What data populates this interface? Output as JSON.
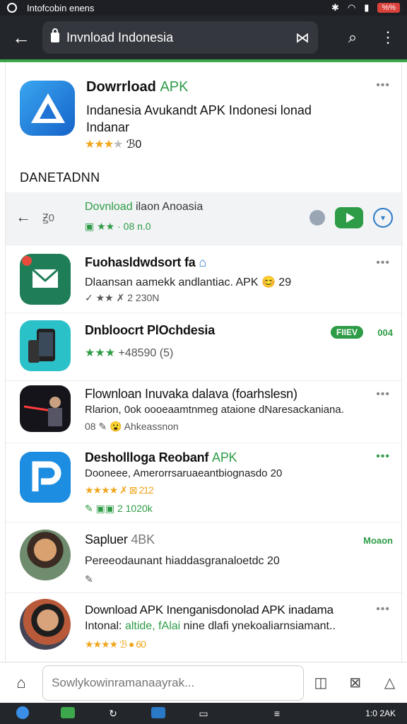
{
  "status_bar": {
    "title": "Intofcobin enens",
    "battery": "%%"
  },
  "toolbar": {
    "back_glyph": "←",
    "url": "Invnload Indonesia",
    "tabs_glyph": "⋈",
    "search_glyph": "⌕",
    "menu_glyph": "⋮"
  },
  "top_card": {
    "title": "Dowrrload",
    "title_accent": "APK",
    "description": "Indanesia Avukandt APK Indonesi lonad Indanar",
    "stars": "★★★",
    "rating_value": "ℬ0",
    "more": "•••"
  },
  "section_label": "DANETADNN",
  "download_bar": {
    "back_glyph": "←",
    "small": "Ꙃ0",
    "title_green": "Dovnload",
    "title_dark": "ilaon Anoasia",
    "meta": "▣ ★★ · 08 n.0"
  },
  "items": [
    {
      "name": "Fuohasldwdsort fa",
      "line": "Dlaansan aamekk andlantiac. APK",
      "line_accent": "😊 29",
      "meta": "✓ ★★ ✗ 2 230N",
      "more": "•••"
    },
    {
      "name": "Dnbloocrt PlOchdesia",
      "badge": "FIIEV",
      "side": "004",
      "meta_green": "★★★",
      "meta": "+48590  (5)"
    },
    {
      "name": "Flownloan Inuvaka dalava (foarhslesn)",
      "line": "Rlarion, 0ok oooeaamtnmeg ataione dNaresackaniana.",
      "meta": "08 ✎ 😮 Ahkeassnon",
      "more": "•••"
    },
    {
      "name": "Deshollloga Reobanf",
      "name_accent": "APK",
      "line": "Dooneee, Amerorrsaruaeantbiognasdo 20",
      "meta": "★★★★ ✗ ⊠ 212",
      "meta2": "✎ ▣▣ 2 1020k",
      "more": "•••"
    },
    {
      "name": "Sapluer",
      "name_suffix": "4BK",
      "side": "Moaon",
      "line": "Pereeodaunant hiaddasgranaloetdc 20",
      "meta": "✎"
    },
    {
      "name": "Download APK Inenganisdonolad APK inadama",
      "line": "Intonal:",
      "line_accent": "altide, fAlai",
      "line_rest": "nine dlafi ynekoaliarnsiamant..",
      "meta": "★★★★ ℬ ● 60",
      "more": "•••"
    }
  ],
  "bottom_bar": {
    "search_placeholder": "Sowlykowinramanaayrak...",
    "home_glyph": "⌂",
    "tab_glyph": "⊠",
    "house_glyph": "△"
  },
  "taskbar": {
    "right": "1:0 2AK"
  }
}
